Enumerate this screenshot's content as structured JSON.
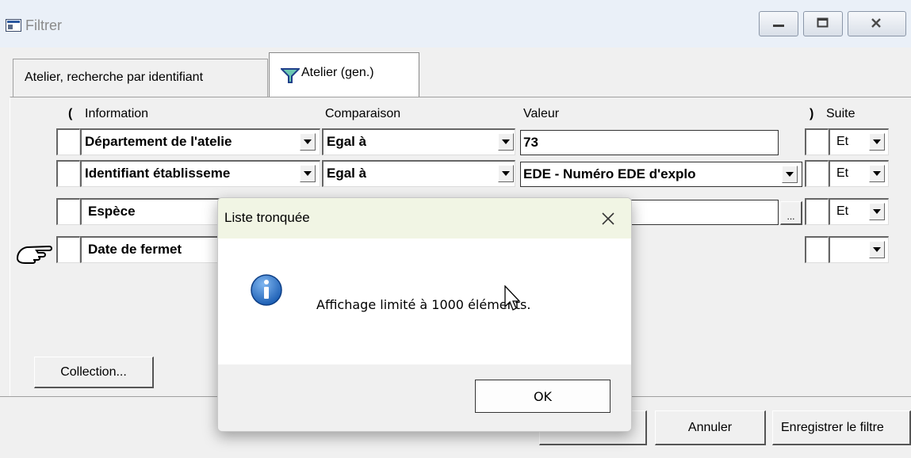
{
  "window": {
    "title": "Filtrer"
  },
  "tabs": [
    {
      "label": "Atelier, recherche par identifiant"
    },
    {
      "label": "Atelier (gen.)",
      "icon": "filter-icon"
    }
  ],
  "columns": {
    "open_paren": "(",
    "information": "Information",
    "comparaison": "Comparaison",
    "valeur": "Valeur",
    "close_paren": ")",
    "suite": "Suite"
  },
  "rows": [
    {
      "information": "Département de l'atelie",
      "comparaison": "Egal à",
      "valeur": "73",
      "suite": "Et"
    },
    {
      "information": "Identifiant établisseme",
      "comparaison": "Egal à",
      "valeur": "EDE - Numéro EDE d'explo",
      "suite": "Et"
    },
    {
      "information": "Espèce",
      "comparaison": "",
      "valeur": "",
      "suite": "Et",
      "value_button": "..."
    },
    {
      "information": "Date de fermet",
      "comparaison": "",
      "valeur": "",
      "suite": ""
    }
  ],
  "buttons": {
    "collection": "Collection...",
    "ok": "OK",
    "annuler": "Annuler",
    "enregistrer": "Enregistrer le filtre"
  },
  "dialog": {
    "title": "Liste tronquée",
    "close": "✕",
    "message": "Affichage limité à 1000 éléments.",
    "ok": "OK",
    "icon": "info-icon"
  },
  "colors": {
    "dialog_title_bg": "#f1f5e4",
    "info_icon": "#1d5fb4"
  }
}
